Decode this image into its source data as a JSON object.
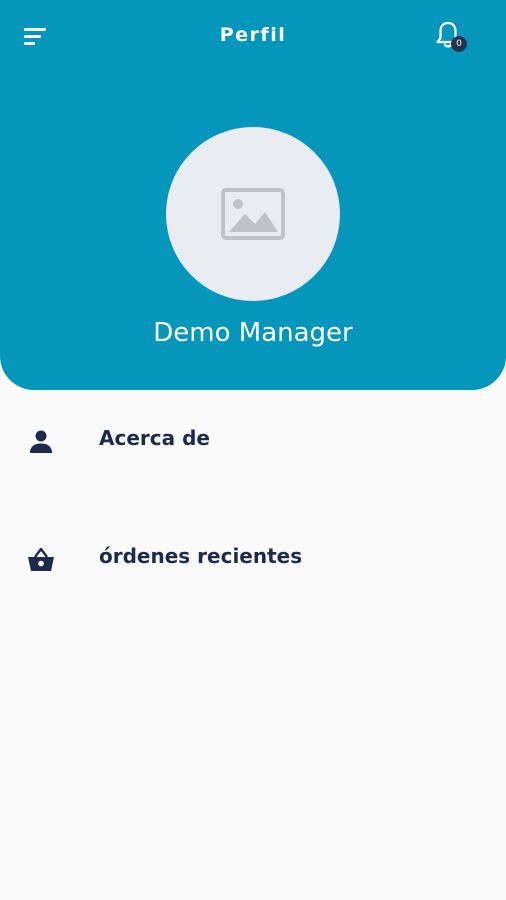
{
  "header": {
    "title": "Perfil",
    "notifications": {
      "count": "0"
    },
    "profile_name": "Demo Manager"
  },
  "menu": {
    "items": [
      {
        "label": "Acerca de",
        "icon": "person-icon"
      },
      {
        "label": "órdenes recientes",
        "icon": "basket-icon"
      }
    ]
  },
  "colors": {
    "header_bg": "#0596bb",
    "text_dark": "#1c2a4e",
    "avatar_bg": "#e9ecf0",
    "badge_bg": "#22344f",
    "page_bg": "#fafafb"
  }
}
